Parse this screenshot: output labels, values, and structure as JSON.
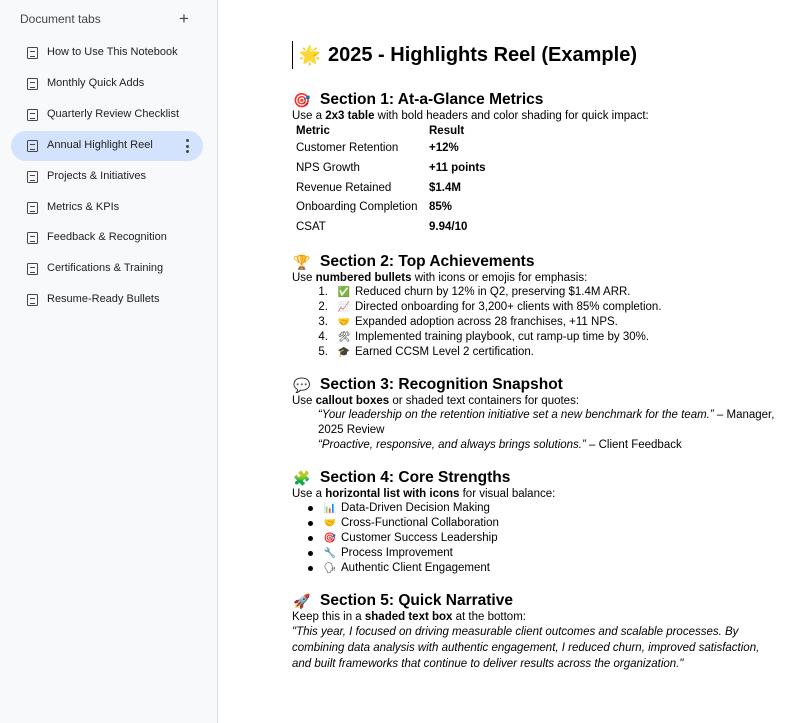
{
  "sidebar": {
    "title": "Document tabs",
    "add_icon": "+",
    "tabs": [
      {
        "label": "How to Use This Notebook"
      },
      {
        "label": "Monthly Quick Adds"
      },
      {
        "label": "Quarterly Review Checklist"
      },
      {
        "label": "Annual Highlight Reel",
        "active": true
      },
      {
        "label": "Projects & Initiatives"
      },
      {
        "label": "Metrics & KPIs"
      },
      {
        "label": "Feedback & Recognition"
      },
      {
        "label": "Certifications & Training"
      },
      {
        "label": "Resume-Ready Bullets"
      }
    ]
  },
  "doc": {
    "title_emoji": "🌟",
    "title": "2025 - Highlights Reel (Example)",
    "section1": {
      "emoji": "🎯",
      "heading": "Section 1: At-a-Glance Metrics",
      "intro_pre": "Use a ",
      "intro_bold": "2x3 table",
      "intro_post": " with bold headers and color shading for quick impact:",
      "table_headers": [
        "Metric",
        "Result"
      ],
      "rows": [
        [
          "Customer Retention",
          "+12%"
        ],
        [
          "NPS Growth",
          "+11 points"
        ],
        [
          "Revenue Retained",
          "$1.4M"
        ],
        [
          "Onboarding Completion",
          "85%"
        ],
        [
          "CSAT",
          "9.94/10"
        ]
      ]
    },
    "section2": {
      "emoji": "🏆",
      "heading": "Section 2: Top Achievements",
      "intro_pre": "Use ",
      "intro_bold": "numbered bullets",
      "intro_post": " with icons or emojis for emphasis:",
      "items": [
        {
          "num": "1.",
          "emoji": "✅",
          "text": "Reduced churn by 12% in Q2, preserving $1.4M ARR."
        },
        {
          "num": "2.",
          "emoji": "📈",
          "text": "Directed onboarding for 3,200+ clients with 85% completion."
        },
        {
          "num": "3.",
          "emoji": "🤝",
          "text": "Expanded adoption across 28 franchises, +11 NPS."
        },
        {
          "num": "4.",
          "emoji": "🛠",
          "text": "Implemented training playbook, cut ramp-up time by 30%."
        },
        {
          "num": "5.",
          "emoji": "🎓",
          "text": "Earned CCSM Level 2 certification."
        }
      ]
    },
    "section3": {
      "emoji": "💬",
      "heading": "Section 3: Recognition Snapshot",
      "intro_pre": "Use ",
      "intro_bold": "callout boxes",
      "intro_post": " or shaded text containers for quotes:",
      "quotes": [
        {
          "quote": "“Your leadership on the retention initiative set a new benchmark for the team.”",
          "source": " – Manager, 2025 Review"
        },
        {
          "quote": "“Proactive, responsive, and always brings solutions.”",
          "source": " – Client Feedback"
        }
      ]
    },
    "section4": {
      "emoji": "🧩",
      "heading": "Section 4: Core Strengths",
      "intro_pre": "Use a ",
      "intro_bold": "horizontal list with icons",
      "intro_post": " for visual balance:",
      "items": [
        {
          "emoji": "📊",
          "text": "Data-Driven Decision Making"
        },
        {
          "emoji": "🤝",
          "text": "Cross-Functional Collaboration"
        },
        {
          "emoji": "🎯",
          "text": "Customer Success Leadership"
        },
        {
          "emoji": "🔧",
          "text": "Process Improvement"
        },
        {
          "emoji": "🗣",
          "text": "Authentic Client Engagement"
        }
      ]
    },
    "section5": {
      "emoji": "🚀",
      "heading": "Section 5: Quick Narrative",
      "intro_pre": "Keep this in a ",
      "intro_bold": "shaded text box",
      "intro_post": " at the bottom:",
      "narrative": "\"This year, I focused on driving measurable client outcomes and scalable processes. By combining data analysis with authentic engagement, I reduced churn, improved satisfaction, and built frameworks that continue to deliver results across the organization.\""
    }
  }
}
